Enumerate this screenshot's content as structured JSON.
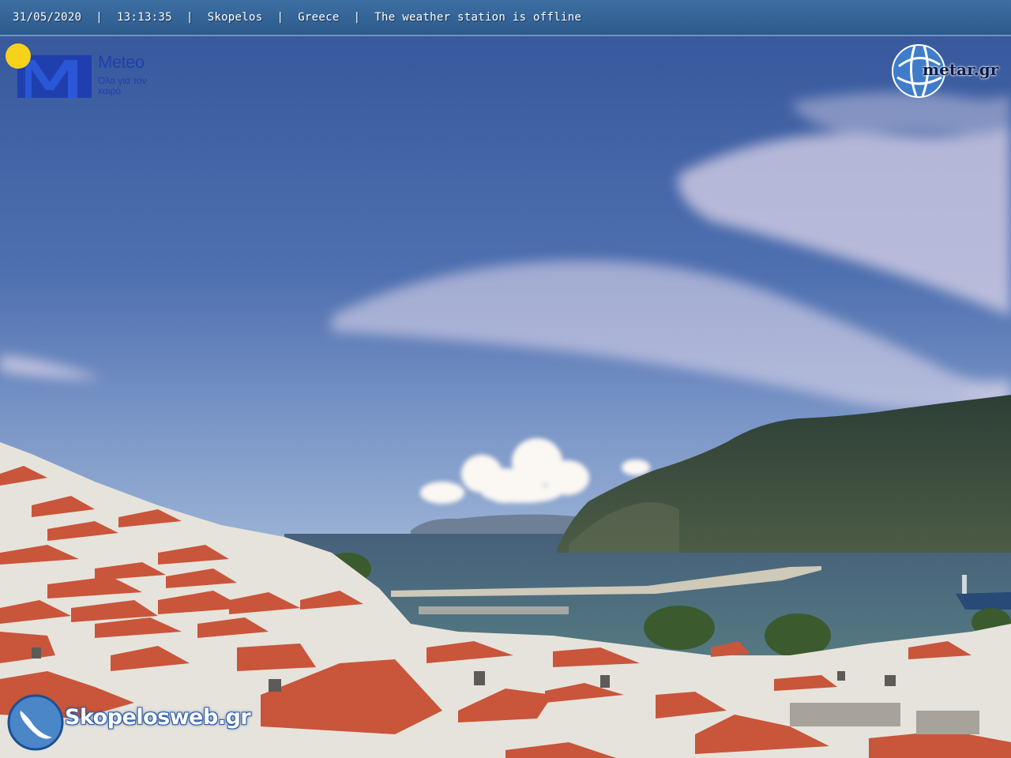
{
  "overlay": {
    "date": "31/05/2020",
    "time": "13:13:35",
    "location": "Skopelos",
    "country": "Greece",
    "status": "The weather station is offline",
    "separator": "|"
  },
  "logos": {
    "meteo": {
      "name": "Meteo",
      "tagline": "Όλα για τον καιρό",
      "icon": "meteo-m-sun-logo",
      "color": "#1f3fae"
    },
    "metar": {
      "name": "metar.gr",
      "icon": "metar-globe-logo"
    },
    "skopelosweb": {
      "name": "Skopelosweb.gr",
      "icon": "skopelos-island-logo"
    }
  },
  "colors": {
    "sky_top": "#34559a",
    "sky_horizon": "#93aed4",
    "sea": "#4a6675",
    "mountain": "#34483a",
    "roof": "#c9553a",
    "wall": "#e8e6e0"
  }
}
